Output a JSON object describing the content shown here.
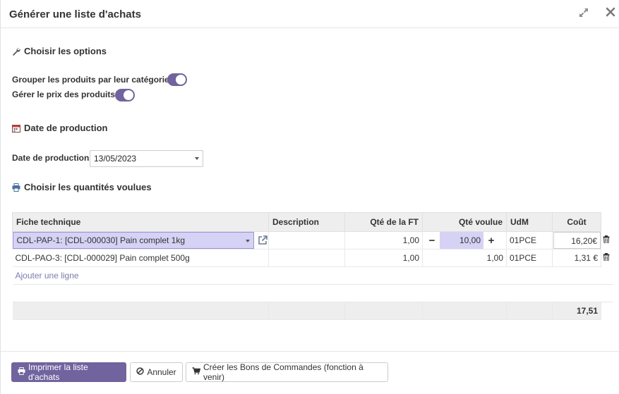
{
  "dialog": {
    "title": "Générer une liste d'achats"
  },
  "options_section": {
    "title": "Choisir les options",
    "group_by_category_label": "Grouper les produits par leur catégorie",
    "group_by_category_on": true,
    "manage_prices_label": "Gérer le prix des produits",
    "manage_prices_on": true
  },
  "production_section": {
    "title": "Date de production",
    "date_label": "Date de production",
    "date_value": "13/05/2023"
  },
  "quantities_section": {
    "title": "Choisir les quantités voulues"
  },
  "table": {
    "headers": [
      "Fiche technique",
      "Description",
      "Qté de la FT",
      "Qté voulue",
      "UdM",
      "Coût"
    ],
    "rows": [
      {
        "sheet": "CDL-PAP-1: [CDL-000030] Pain complet 1kg",
        "description": "",
        "ft_qty": "1,00",
        "wanted_qty": "10,00",
        "uom": "01PCE",
        "cost": "16,20€"
      },
      {
        "sheet": "CDL-PAO-3: [CDL-000029] Pain complet 500g",
        "description": "",
        "ft_qty": "1,00",
        "wanted_qty": "1,00",
        "uom": "01PCE",
        "cost": "1,31 €"
      }
    ],
    "add_line": "Ajouter une ligne",
    "total": "17,51"
  },
  "footer": {
    "print_label": "Imprimer la liste d'achats",
    "cancel_label": "Annuler",
    "create_orders_label": "Créer les Bons de Commandes (fonction à venir)"
  },
  "colors": {
    "accent": "#71639e",
    "selected_cell": "#d6d2f5"
  }
}
